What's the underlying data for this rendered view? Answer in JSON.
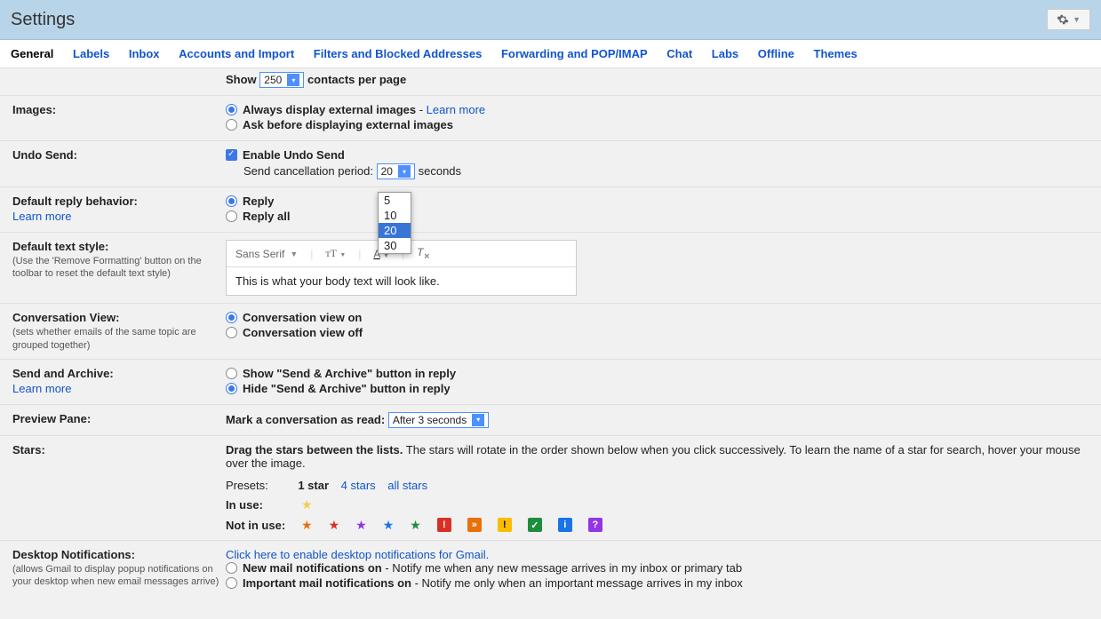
{
  "header": {
    "title": "Settings"
  },
  "tabs": [
    "General",
    "Labels",
    "Inbox",
    "Accounts and Import",
    "Filters and Blocked Addresses",
    "Forwarding and POP/IMAP",
    "Chat",
    "Labs",
    "Offline",
    "Themes"
  ],
  "active_tab": "General",
  "contacts": {
    "show": "Show",
    "value": "250",
    "suffix": "contacts per page"
  },
  "images": {
    "label": "Images:",
    "opt1": "Always display external images",
    "learn": "Learn more",
    "opt2": "Ask before displaying external images"
  },
  "undo": {
    "label": "Undo Send:",
    "enable": "Enable Undo Send",
    "period_label": "Send cancellation period:",
    "value": "20",
    "suffix": "seconds",
    "options": [
      "5",
      "10",
      "20",
      "30"
    ]
  },
  "reply": {
    "label": "Default reply behavior:",
    "learn": "Learn more",
    "opt1": "Reply",
    "opt2": "Reply all"
  },
  "textstyle": {
    "label": "Default text style:",
    "sub": "(Use the 'Remove Formatting' button on the toolbar to reset the default text style)",
    "font": "Sans Serif",
    "sample": "This is what your body text will look like."
  },
  "conv": {
    "label": "Conversation View:",
    "sub": "(sets whether emails of the same topic are grouped together)",
    "opt1": "Conversation view on",
    "opt2": "Conversation view off"
  },
  "archive": {
    "label": "Send and Archive:",
    "learn": "Learn more",
    "opt1": "Show \"Send & Archive\" button in reply",
    "opt2": "Hide \"Send & Archive\" button in reply"
  },
  "preview": {
    "label": "Preview Pane:",
    "mark": "Mark a conversation as read:",
    "value": "After 3 seconds"
  },
  "stars": {
    "label": "Stars:",
    "desc1": "Drag the stars between the lists.",
    "desc2": "The stars will rotate in the order shown below when you click successively. To learn the name of a star for search, hover your mouse over the image.",
    "presets": "Presets:",
    "p1": "1 star",
    "p4": "4 stars",
    "pall": "all stars",
    "inuse": "In use:",
    "notinuse": "Not in use:"
  },
  "desktop": {
    "label": "Desktop Notifications:",
    "sub": "(allows Gmail to display popup notifications on your desktop when new email messages arrive)",
    "enable_link": "Click here to enable desktop notifications for Gmail.",
    "opt1a": "New mail notifications on",
    "opt1b": " - Notify me when any new message arrives in my inbox or primary tab",
    "opt2a": "Important mail notifications on",
    "opt2b": " - Notify me only when an important message arrives in my inbox"
  }
}
